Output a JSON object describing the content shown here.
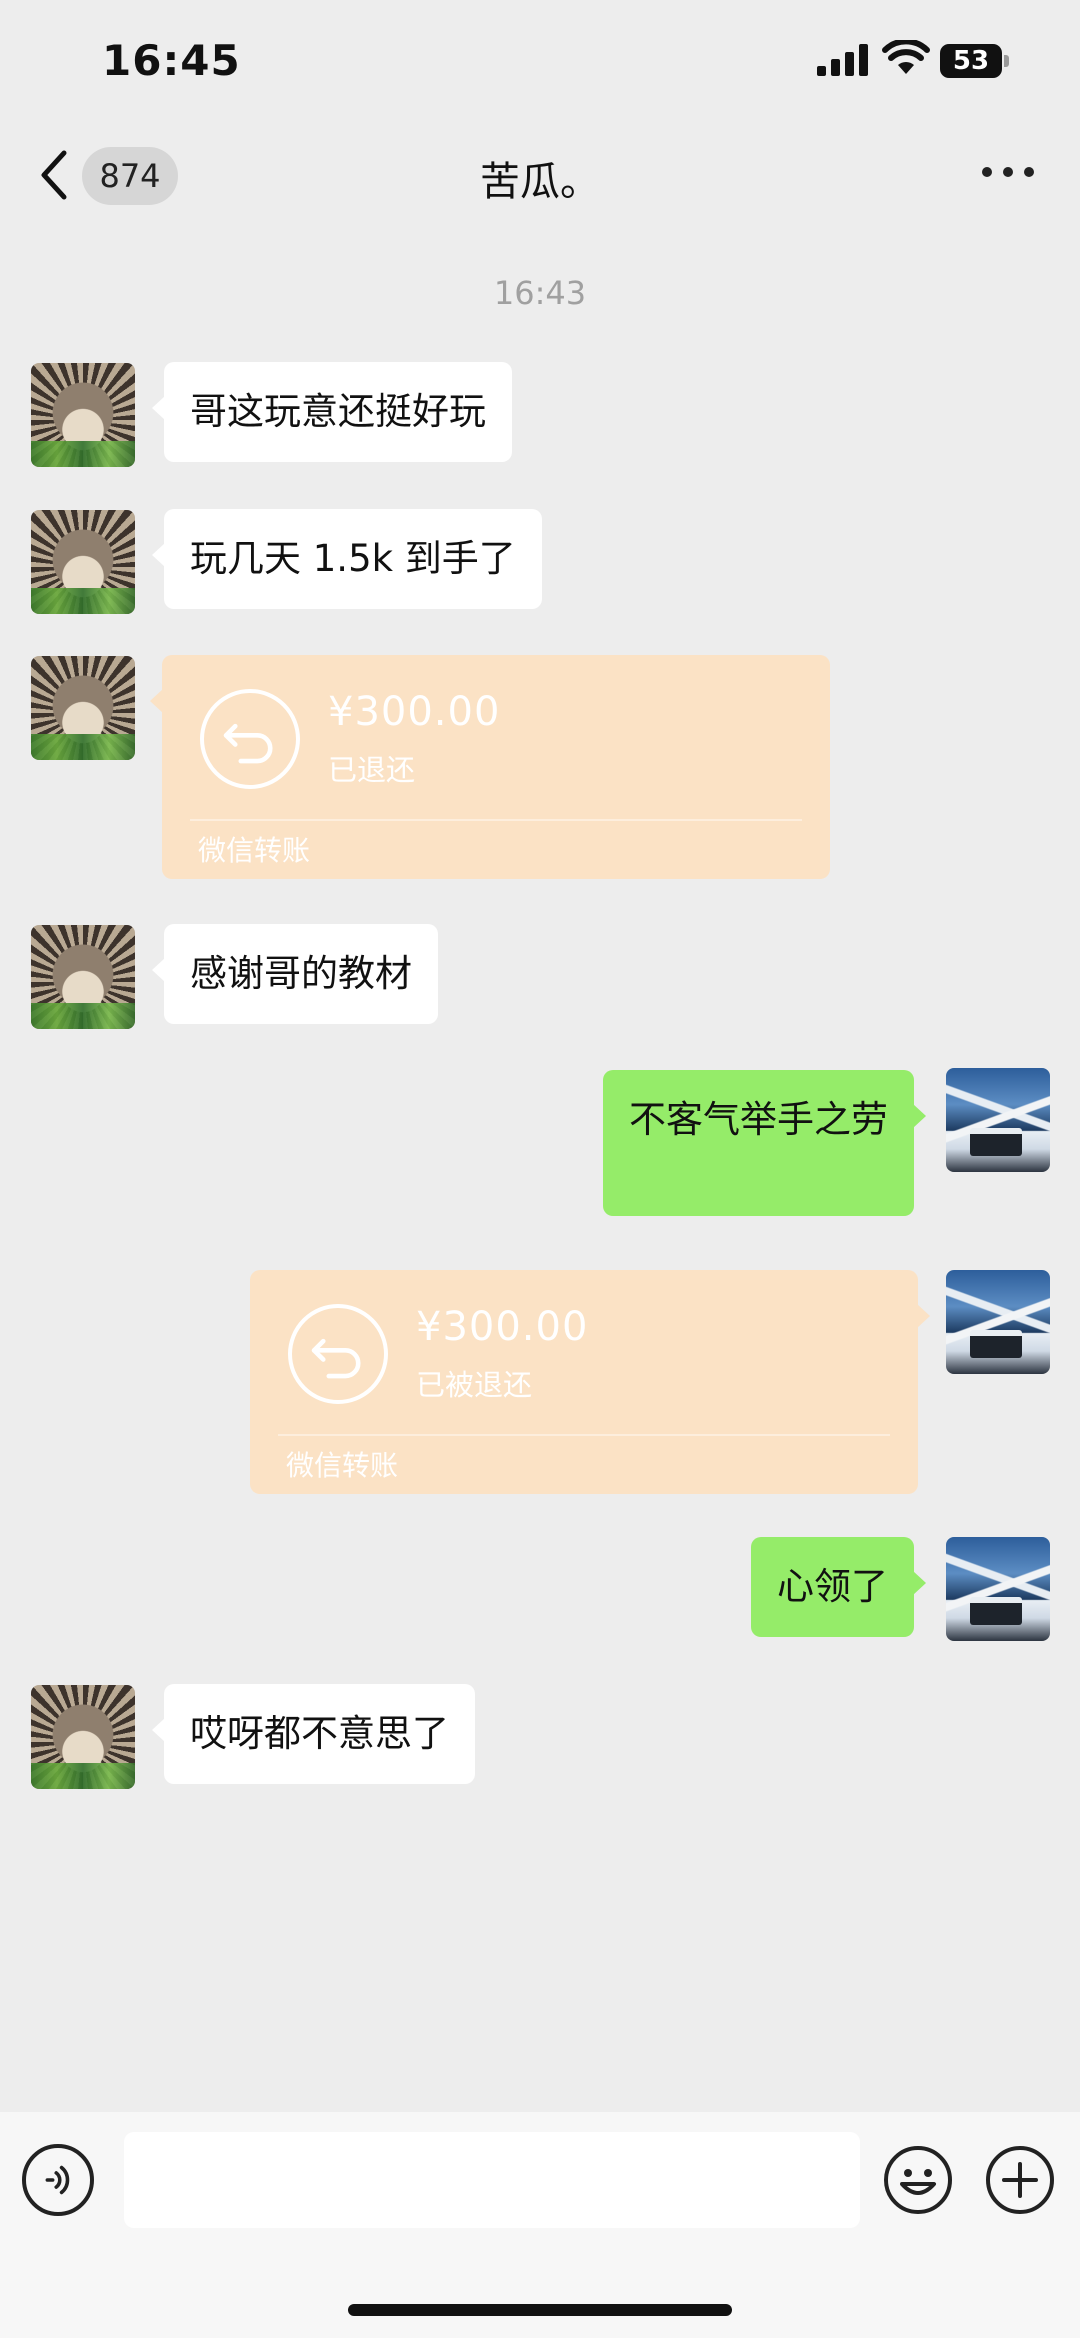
{
  "status_bar": {
    "time": "16:45",
    "battery_level": "53"
  },
  "nav": {
    "unread_count": "874",
    "title": "苦瓜。"
  },
  "timestamp": "16:43",
  "messages": [
    {
      "side": "in",
      "type": "text",
      "text": "哥这玩意还挺好玩"
    },
    {
      "side": "in",
      "type": "text",
      "text": "玩几天 1.5k 到手了"
    },
    {
      "side": "in",
      "type": "transfer",
      "amount": "¥300.00",
      "status": "已退还",
      "label": "微信转账"
    },
    {
      "side": "in",
      "type": "text",
      "text": "感谢哥的教材"
    },
    {
      "side": "out",
      "type": "text",
      "text": "不客气举手之劳"
    },
    {
      "side": "out",
      "type": "transfer",
      "amount": "¥300.00",
      "status": "已被退还",
      "label": "微信转账"
    },
    {
      "side": "out",
      "type": "text",
      "text": "心领了"
    },
    {
      "side": "in",
      "type": "text",
      "text": "哎呀都不意思了"
    }
  ],
  "input_bar": {
    "placeholder": ""
  },
  "colors": {
    "background": "#ededed",
    "incoming_bubble": "#ffffff",
    "outgoing_bubble": "#95ec69",
    "transfer_card": "#fbe2c5"
  },
  "icons": {
    "back": "chevron-left-icon",
    "more": "more-dots-icon",
    "voice": "voice-icon",
    "emoji": "emoji-icon",
    "plus": "plus-icon",
    "transfer": "return-arrow-icon"
  }
}
